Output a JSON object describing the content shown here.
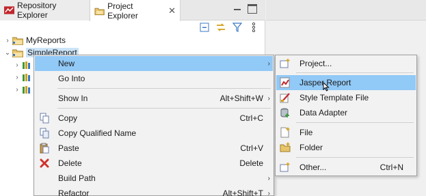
{
  "tabs": {
    "repository": "Repository Explorer",
    "project": "Project Explorer",
    "close_glyph": "✕"
  },
  "tree": {
    "items": [
      {
        "label": "MyReports"
      },
      {
        "label": "SimpleReport"
      }
    ]
  },
  "context_menu": {
    "new": {
      "label": "New"
    },
    "go_into": {
      "label": "Go Into"
    },
    "show_in": {
      "label": "Show In",
      "accel": "Alt+Shift+W"
    },
    "copy": {
      "label": "Copy",
      "accel": "Ctrl+C"
    },
    "copy_qualified": {
      "label": "Copy Qualified Name"
    },
    "paste": {
      "label": "Paste",
      "accel": "Ctrl+V"
    },
    "delete": {
      "label": "Delete",
      "accel": "Delete"
    },
    "build_path": {
      "label": "Build Path"
    },
    "refactor": {
      "label": "Refactor",
      "accel": "Alt+Shift+T"
    }
  },
  "submenu": {
    "project": {
      "label": "Project..."
    },
    "jasper_report": {
      "label": "Jasper Report"
    },
    "style_template": {
      "label": "Style Template File"
    },
    "data_adapter": {
      "label": "Data Adapter"
    },
    "file": {
      "label": "File"
    },
    "folder": {
      "label": "Folder"
    },
    "other": {
      "label": "Other...",
      "accel": "Ctrl+N"
    }
  },
  "colors": {
    "highlight": "#91c9f7",
    "selection": "#cce4f7",
    "jasper_red": "#c0282d"
  }
}
